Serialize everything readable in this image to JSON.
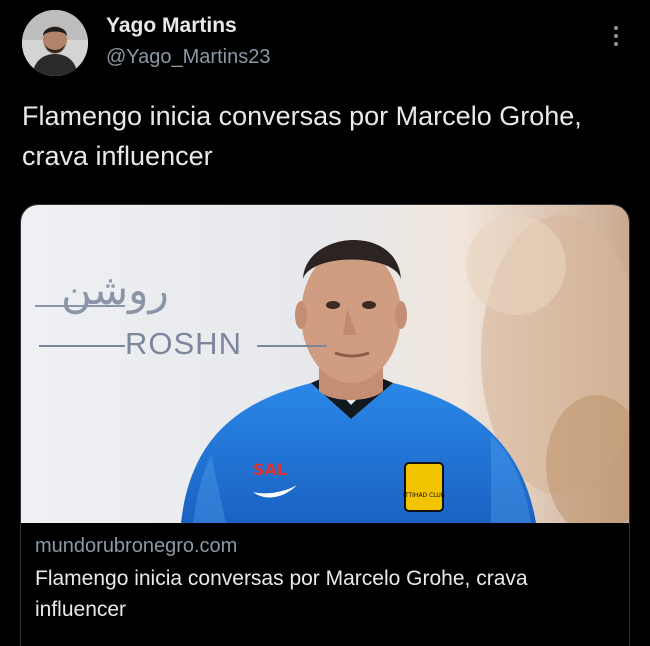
{
  "tweet": {
    "author_name": "Yago Martins",
    "author_handle": "@Yago_Martins23",
    "text": "Flamengo inicia conversas por Marcelo Grohe, crava influencer"
  },
  "card": {
    "domain": "mundorubronegro.com",
    "title": "Flamengo inicia conversas por Marcelo Grohe, crava influencer",
    "image": {
      "sponsor_arabic": "روشن",
      "sponsor_latin": "ROSHN",
      "jersey_sponsor": "SAL",
      "badge_text": "ITTIHAD CLUB"
    }
  },
  "colors": {
    "background": "#000000",
    "primary_text": "#e7e9ea",
    "secondary_text": "#8b98a5",
    "border": "#2f3336",
    "jersey_blue": "#1f74d6"
  },
  "icons": {
    "more": "more-vertical-icon"
  }
}
